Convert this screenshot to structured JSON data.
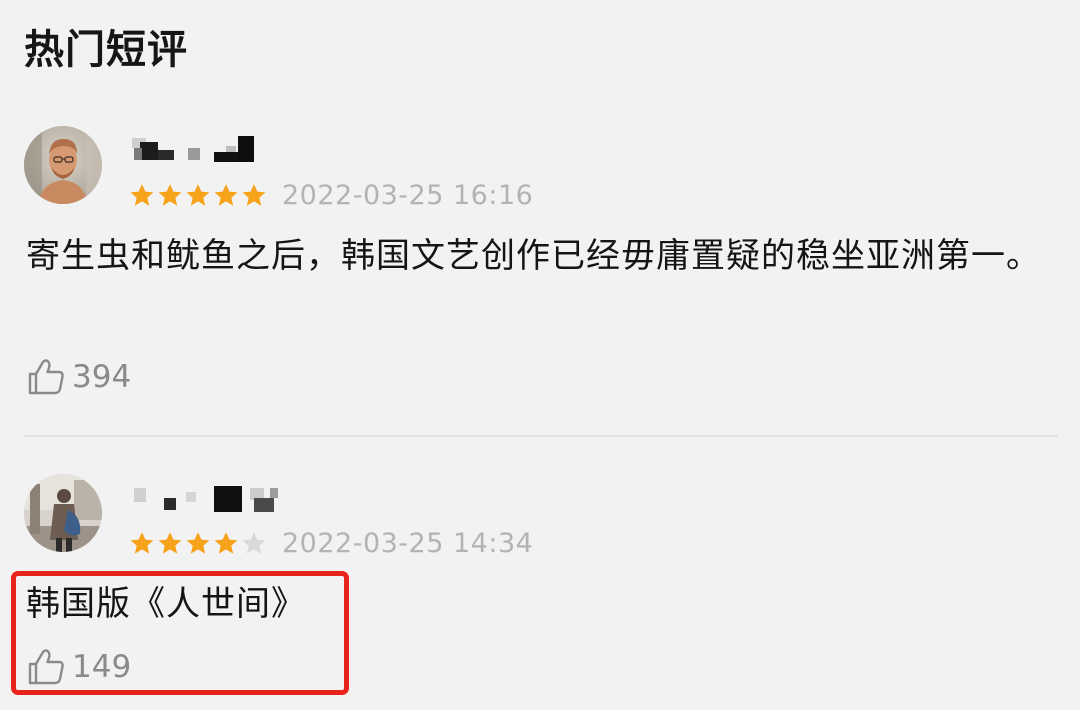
{
  "section": {
    "title": "热门短评"
  },
  "reviews": [
    {
      "username": "",
      "rating": 5,
      "max_rating": 5,
      "timestamp": "2022-03-25 16:16",
      "text": "寄生虫和鱿鱼之后，韩国文艺创作已经毋庸置疑的稳坐亚洲第一。",
      "likes": "394"
    },
    {
      "username": "",
      "rating": 4,
      "max_rating": 5,
      "timestamp": "2022-03-25 14:34",
      "text": "韩国版《人世间》",
      "likes": "149"
    }
  ],
  "icons": {
    "star_filled": "star-filled-icon",
    "star_empty": "star-empty-icon",
    "like": "thumbs-up-icon"
  },
  "colors": {
    "star_filled": "#f7a21b",
    "star_empty": "#d9d9d9",
    "timestamp": "#b3b3b3",
    "like_count": "#8a8a8a",
    "highlight": "#e8231e",
    "background": "#f2f2f2"
  }
}
